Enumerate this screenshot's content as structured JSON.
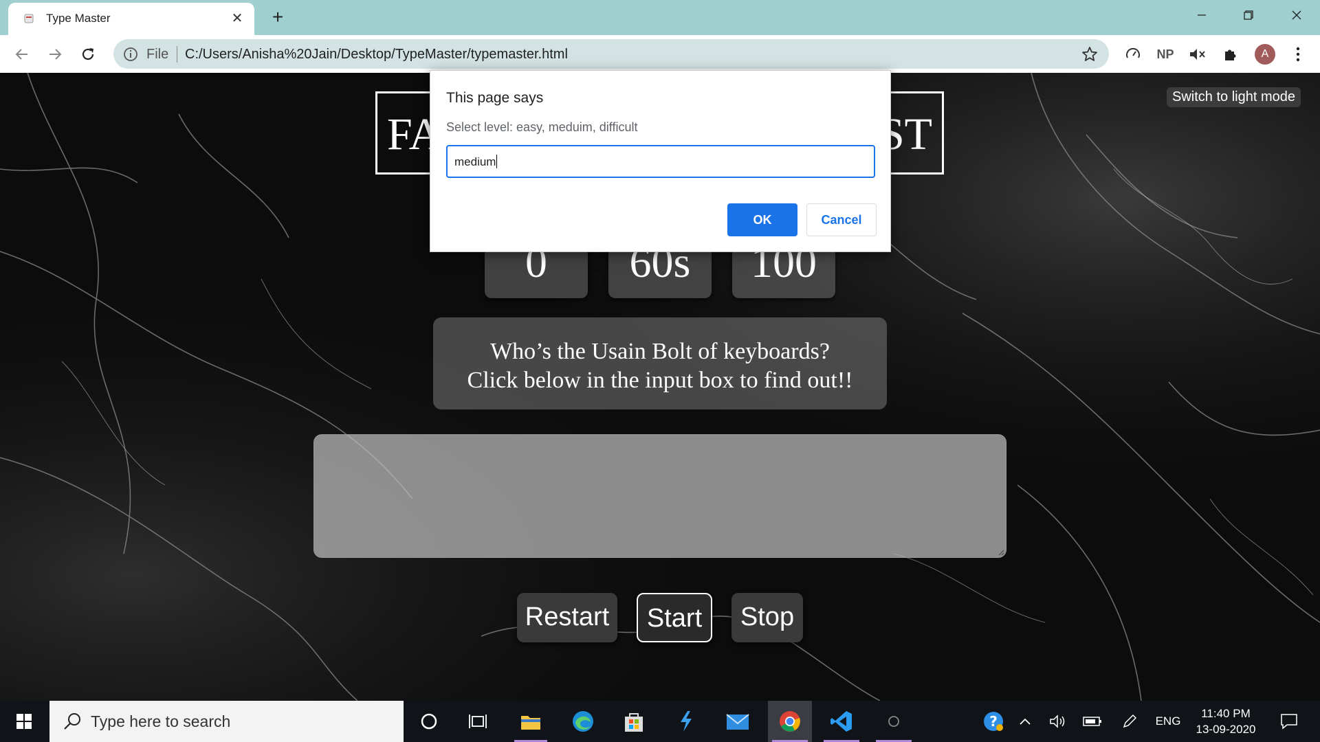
{
  "browser": {
    "tab_title": "Type Master",
    "tab_close": "✕",
    "new_tab": "+",
    "file_label": "File",
    "url": "C:/Users/Anisha%20Jain/Desktop/TypeMaster/typemaster.html",
    "extension_np": "NP",
    "avatar_letter": "A"
  },
  "page": {
    "mode_toggle": "Switch to light mode",
    "title_left": "FA",
    "title_right": "ST",
    "stats": [
      "0",
      "60s",
      "100"
    ],
    "prompt_line1": "Who’s the Usain Bolt of keyboards?",
    "prompt_line2": "Click below in the input box to find out!!",
    "buttons": {
      "restart": "Restart",
      "start": "Start",
      "stop": "Stop"
    }
  },
  "dialog": {
    "title": "This page says",
    "message": "Select level: easy, meduim, difficult",
    "input_value": "medium",
    "ok": "OK",
    "cancel": "Cancel"
  },
  "taskbar": {
    "search_placeholder": "Type here to search",
    "language": "ENG",
    "time": "11:40 PM",
    "date": "13-09-2020"
  },
  "colors": {
    "tabstrip": "#9fd0cf",
    "omnibox": "#d3e3e3",
    "dialog_accent": "#1a73e8",
    "taskbar": "#101418"
  }
}
